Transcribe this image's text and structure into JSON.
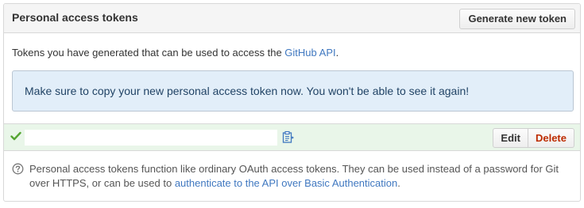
{
  "header": {
    "title": "Personal access tokens",
    "generate_button": "Generate new token"
  },
  "intro": {
    "text": "Tokens you have generated that can be used to access the ",
    "link": "GitHub API",
    "suffix": "."
  },
  "flash": {
    "message": "Make sure to copy your new personal access token now. You won't be able to see it again!"
  },
  "token": {
    "value": "",
    "status_icon": "check-icon",
    "copy_icon": "clipboard-icon",
    "edit_label": "Edit",
    "delete_label": "Delete"
  },
  "help": {
    "icon": "question-icon",
    "text": "Personal access tokens function like ordinary OAuth access tokens. They can be used instead of a password for Git over HTTPS, or can be used to ",
    "link": "authenticate to the API over Basic Authentication",
    "suffix": "."
  },
  "colors": {
    "link": "#4078c0",
    "flash_bg": "#e2eef9",
    "success_row_bg": "#e9f6e9",
    "check": "#55a532",
    "delete": "#bd2c00"
  }
}
